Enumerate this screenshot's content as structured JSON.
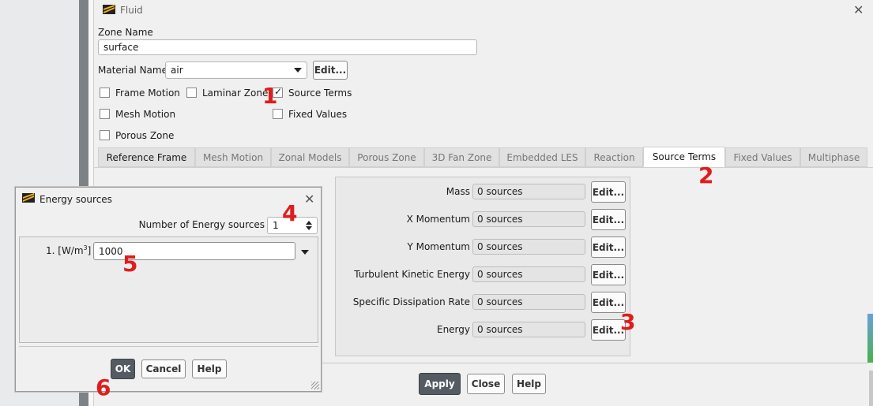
{
  "main_window": {
    "title": "Fluid",
    "zone_name_label": "Zone Name",
    "zone_name_value": "surface",
    "material_name_label": "Material Name",
    "material_name_value": "air",
    "material_edit_label": "Edit...",
    "checkboxes": {
      "frame_motion": "Frame Motion",
      "laminar_zone": "Laminar Zone",
      "source_terms": "Source Terms",
      "mesh_motion": "Mesh Motion",
      "fixed_values": "Fixed Values",
      "porous_zone": "Porous Zone"
    },
    "source_terms_checked": true,
    "tabs": [
      "Reference Frame",
      "Mesh Motion",
      "Zonal Models",
      "Porous Zone",
      "3D Fan Zone",
      "Embedded LES",
      "Reaction",
      "Source Terms",
      "Fixed Values",
      "Multiphase"
    ],
    "active_tab": "Source Terms",
    "sources": [
      {
        "label": "Mass",
        "value": "0 sources",
        "edit": "Edit..."
      },
      {
        "label": "X Momentum",
        "value": "0 sources",
        "edit": "Edit..."
      },
      {
        "label": "Y Momentum",
        "value": "0 sources",
        "edit": "Edit..."
      },
      {
        "label": "Turbulent Kinetic Energy",
        "value": "0 sources",
        "edit": "Edit..."
      },
      {
        "label": "Specific Dissipation Rate",
        "value": "0 sources",
        "edit": "Edit..."
      },
      {
        "label": "Energy",
        "value": "0 sources",
        "edit": "Edit..."
      }
    ],
    "buttons": {
      "apply": "Apply",
      "close": "Close",
      "help": "Help"
    }
  },
  "energy_dialog": {
    "title": "Energy sources",
    "num_label": "Number of Energy sources",
    "num_value": "1",
    "row_label": "1. [W/m",
    "row_label_sup": "3",
    "row_label_end": "]",
    "row_value": "1000",
    "buttons": {
      "ok": "OK",
      "cancel": "Cancel",
      "help": "Help"
    }
  },
  "annotations": [
    "1",
    "2",
    "3",
    "4",
    "5",
    "6"
  ],
  "colors": {
    "annotation": "#e01c1c",
    "primary_button": "#555b63",
    "accent_strip": "#7d8287"
  }
}
